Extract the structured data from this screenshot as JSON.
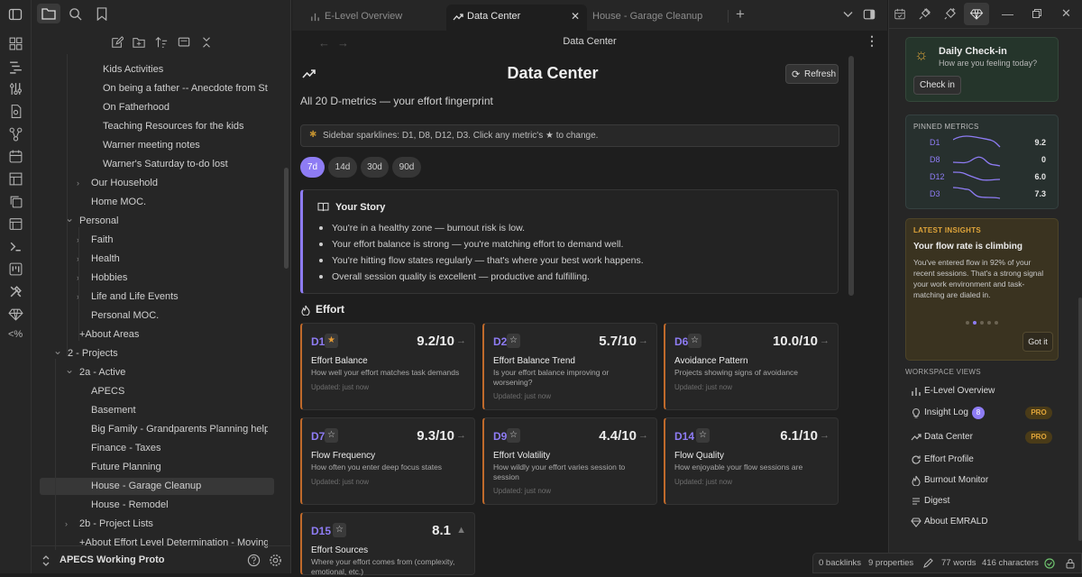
{
  "file_tree": {
    "items": [
      {
        "label": "Kids Activities",
        "indent": 3,
        "caret": ""
      },
      {
        "label": "On being a father -- Anecdote from Steph...",
        "indent": 3,
        "caret": ""
      },
      {
        "label": "On Fatherhood",
        "indent": 3,
        "caret": ""
      },
      {
        "label": "Teaching Resources for the kids",
        "indent": 3,
        "caret": ""
      },
      {
        "label": "Warner meeting notes",
        "indent": 3,
        "caret": ""
      },
      {
        "label": "Warner's Saturday to-do lost",
        "indent": 3,
        "caret": ""
      },
      {
        "label": "Our Household",
        "indent": 2,
        "caret": "right"
      },
      {
        "label": "Home MOC.",
        "indent": 2,
        "caret": ""
      },
      {
        "label": "Personal",
        "indent": 1,
        "caret": "down"
      },
      {
        "label": "Faith",
        "indent": 2,
        "caret": "right"
      },
      {
        "label": "Health",
        "indent": 2,
        "caret": "right"
      },
      {
        "label": "Hobbies",
        "indent": 2,
        "caret": "right"
      },
      {
        "label": "Life and Life Events",
        "indent": 2,
        "caret": "right"
      },
      {
        "label": "Personal MOC.",
        "indent": 2,
        "caret": ""
      },
      {
        "label": "+About Areas",
        "indent": 1,
        "caret": ""
      },
      {
        "label": "2 - Projects",
        "indent": 0,
        "caret": "down"
      },
      {
        "label": "2a - Active",
        "indent": 1,
        "caret": "down"
      },
      {
        "label": "APECS",
        "indent": 2,
        "caret": ""
      },
      {
        "label": "Basement",
        "indent": 2,
        "caret": ""
      },
      {
        "label": "Big Family - Grandparents Planning help",
        "indent": 2,
        "caret": ""
      },
      {
        "label": "Finance - Taxes",
        "indent": 2,
        "caret": ""
      },
      {
        "label": "Future Planning",
        "indent": 2,
        "caret": ""
      },
      {
        "label": "House - Garage Cleanup",
        "indent": 2,
        "caret": "",
        "selected": true
      },
      {
        "label": "House - Remodel",
        "indent": 2,
        "caret": ""
      },
      {
        "label": "2b - Project Lists",
        "indent": 1,
        "caret": "right"
      },
      {
        "label": "+About Effort Level Determination - Moving th",
        "indent": 1,
        "caret": ""
      }
    ],
    "vault_name": "APECS Working Proto"
  },
  "tabs": [
    {
      "label": "E-Level Overview",
      "active": false
    },
    {
      "label": "Data Center",
      "active": true
    },
    {
      "label": "House - Garage Cleanup",
      "active": false
    }
  ],
  "view_header": {
    "title": "Data Center"
  },
  "page": {
    "title": "Data Center",
    "refresh_label": "Refresh",
    "subtitle": "All 20 D-metrics — your effort fingerprint",
    "notice": "Sidebar sparklines: D1, D8, D12, D3. Click any metric's ★ to change.",
    "ranges": [
      "7d",
      "14d",
      "30d",
      "90d"
    ],
    "active_range": "7d",
    "story_title": "Your Story",
    "story_items": [
      "You're in a healthy zone — burnout risk is low.",
      "Your effort balance is strong — you're matching effort to demand well.",
      "You're hitting flow states regularly — that's where your best work happens.",
      "Overall session quality is excellent — productive and fulfilling."
    ],
    "section_title": "Effort",
    "cards": [
      {
        "code": "D1",
        "starred": true,
        "value": "9.2/10",
        "arrow": "→",
        "title": "Effort Balance",
        "desc": "How well your effort matches task demands",
        "updated": "Updated: just now"
      },
      {
        "code": "D2",
        "starred": false,
        "value": "5.7/10",
        "arrow": "→",
        "title": "Effort Balance Trend",
        "desc": "Is your effort balance improving or worsening?",
        "updated": "Updated: just now"
      },
      {
        "code": "D6",
        "starred": false,
        "value": "10.0/10",
        "arrow": "→",
        "title": "Avoidance Pattern",
        "desc": "Projects showing signs of avoidance",
        "updated": "Updated: just now"
      },
      {
        "code": "D7",
        "starred": false,
        "value": "9.3/10",
        "arrow": "→",
        "title": "Flow Frequency",
        "desc": "How often you enter deep focus states",
        "updated": "Updated: just now"
      },
      {
        "code": "D9",
        "starred": false,
        "value": "4.4/10",
        "arrow": "→",
        "title": "Effort Volatility",
        "desc": "How wildly your effort varies session to session",
        "updated": "Updated: just now"
      },
      {
        "code": "D14",
        "starred": false,
        "value": "6.1/10",
        "arrow": "→",
        "title": "Flow Quality",
        "desc": "How enjoyable your flow sessions are",
        "updated": "Updated: just now"
      },
      {
        "code": "D15",
        "starred": false,
        "value": "8.1",
        "arrow": "▲",
        "title": "Effort Sources",
        "desc": "Where your effort comes from (complexity, emotional, etc.)",
        "updated": ""
      }
    ]
  },
  "right_panel": {
    "checkin": {
      "title": "Daily Check-in",
      "subtitle": "How are you feeling today?",
      "button": "Check in"
    },
    "pinned": {
      "title": "PINNED METRICS",
      "items": [
        {
          "code": "D1",
          "value": "9.2"
        },
        {
          "code": "D8",
          "value": "0"
        },
        {
          "code": "D12",
          "value": "6.0"
        },
        {
          "code": "D3",
          "value": "7.3"
        }
      ]
    },
    "insights": {
      "label": "LATEST INSIGHTS",
      "title": "Your flow rate is climbing",
      "body": "You've entered flow in 92% of your recent sessions. That's a strong signal your work environment and task-matching are dialed in.",
      "button": "Got it",
      "page_count": 5,
      "page_active": 2
    },
    "workspace_title": "WORKSPACE VIEWS",
    "views": [
      {
        "label": "E-Level Overview",
        "icon": "chart-icon"
      },
      {
        "label": "Insight Log",
        "icon": "bulb-icon",
        "badge": "8",
        "pro": "PRO"
      },
      {
        "label": "Data Center",
        "icon": "trend-icon",
        "pro": "PRO"
      },
      {
        "label": "Effort Profile",
        "icon": "refresh-icon"
      },
      {
        "label": "Burnout Monitor",
        "icon": "flame-icon"
      },
      {
        "label": "Digest",
        "icon": "digest-icon"
      },
      {
        "label": "About EMRALD",
        "icon": "gem-icon"
      }
    ]
  },
  "status_bar": {
    "backlinks": "0 backlinks",
    "properties": "9 properties",
    "words": "77 words",
    "characters": "416 characters"
  },
  "colors": {
    "accent": "#8e7cf4",
    "orange": "#c06a2b",
    "green_panel": "#25352b",
    "gold_panel": "#3a3320",
    "pro": "#d79b2a"
  }
}
